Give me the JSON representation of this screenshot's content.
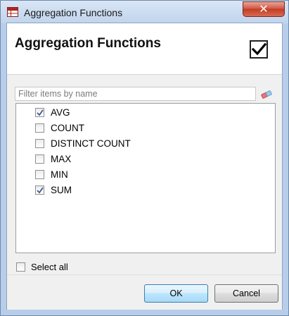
{
  "window": {
    "title": "Aggregation Functions",
    "close_label": "✕",
    "accent_color": "#c03c28"
  },
  "header": {
    "title": "Aggregation Functions",
    "checked": true
  },
  "filter": {
    "placeholder": "Filter items by name",
    "value": "",
    "clear_icon": "eraser-icon"
  },
  "items": [
    {
      "label": "AVG",
      "checked": true
    },
    {
      "label": "COUNT",
      "checked": false
    },
    {
      "label": "DISTINCT COUNT",
      "checked": false
    },
    {
      "label": "MAX",
      "checked": false
    },
    {
      "label": "MIN",
      "checked": false
    },
    {
      "label": "SUM",
      "checked": true
    }
  ],
  "select_all": {
    "label": "Select all",
    "checked": false
  },
  "buttons": {
    "ok_label": "OK",
    "cancel_label": "Cancel"
  }
}
